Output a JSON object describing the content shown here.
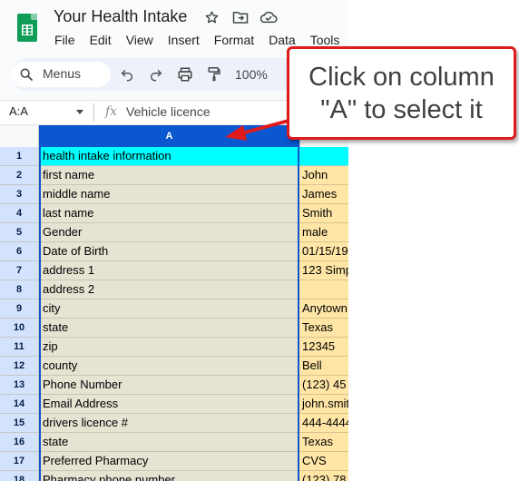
{
  "app": {
    "doc_title": "Your Health Intake",
    "menu": [
      "File",
      "Edit",
      "View",
      "Insert",
      "Format",
      "Data",
      "Tools"
    ]
  },
  "toolbar": {
    "search_label": "Menus",
    "zoom": "100%"
  },
  "formula_bar": {
    "name_box": "A:A",
    "fx_label": "fx",
    "content": "Vehicle licence"
  },
  "grid": {
    "selected_column": "A",
    "rows": [
      {
        "num": "1",
        "a": "health intake information",
        "b": "",
        "highlight": true
      },
      {
        "num": "2",
        "a": "first name",
        "b": "John"
      },
      {
        "num": "3",
        "a": "middle name",
        "b": "James"
      },
      {
        "num": "4",
        "a": "last name",
        "b": "Smith"
      },
      {
        "num": "5",
        "a": "Gender",
        "b": "male"
      },
      {
        "num": "6",
        "a": "Date of Birth",
        "b": "01/15/19"
      },
      {
        "num": "7",
        "a": "address 1",
        "b": "123 Simp"
      },
      {
        "num": "8",
        "a": "address 2",
        "b": ""
      },
      {
        "num": "9",
        "a": "city",
        "b": "Anytown"
      },
      {
        "num": "10",
        "a": "state",
        "b": "Texas"
      },
      {
        "num": "11",
        "a": "zip",
        "b": "12345"
      },
      {
        "num": "12",
        "a": "county",
        "b": "Bell"
      },
      {
        "num": "13",
        "a": "Phone Number",
        "b": "(123) 45"
      },
      {
        "num": "14",
        "a": "Email Address",
        "b": "john.smit"
      },
      {
        "num": "15",
        "a": "drivers licence #",
        "b": "444-4444"
      },
      {
        "num": "16",
        "a": "state",
        "b": "Texas"
      },
      {
        "num": "17",
        "a": "Preferred Pharmacy",
        "b": "CVS"
      },
      {
        "num": "18",
        "a": "Pharmacy phone number",
        "b": "(123) 78"
      }
    ]
  },
  "callout": {
    "text": "Click on column \"A\" to select it",
    "border_color": "#e01b1b"
  },
  "colors": {
    "selection": "#0b57d0",
    "column_a_fill": "#e6e3d3",
    "column_b_fill": "#ffe6a6",
    "header_row_fill": "#00ffff"
  }
}
